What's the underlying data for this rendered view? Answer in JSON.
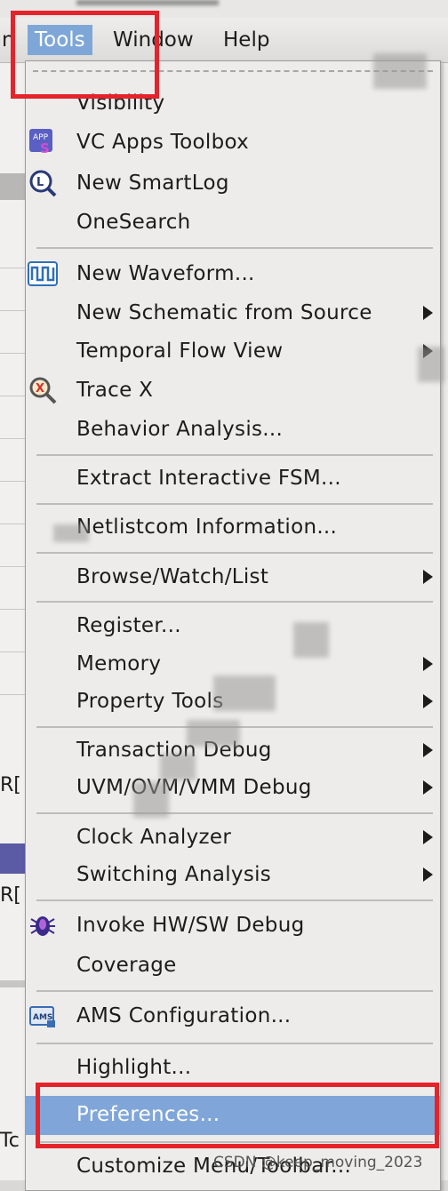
{
  "menubar": {
    "partial_prev_item": "n",
    "tools": "Tools",
    "window": "Window",
    "help": "Help"
  },
  "background": {
    "row_fragment_1": "R[",
    "row_fragment_2": "R[",
    "row_fragment_3": "Tc"
  },
  "tools_menu": {
    "items": [
      {
        "label": "Visibility"
      },
      {
        "label": "VC Apps Toolbox",
        "icon": "vc-apps-icon"
      },
      {
        "label": "New SmartLog",
        "icon": "smartlog-icon"
      },
      {
        "label": "OneSearch"
      },
      {
        "label": "New Waveform...",
        "icon": "waveform-icon"
      },
      {
        "label": "New Schematic from Source",
        "submenu": true
      },
      {
        "label": "Temporal Flow View",
        "submenu": true
      },
      {
        "label": "Trace X",
        "icon": "trace-x-icon"
      },
      {
        "label": "Behavior Analysis..."
      },
      {
        "label": "Extract Interactive FSM..."
      },
      {
        "label": "Netlistcom Information..."
      },
      {
        "label": "Browse/Watch/List",
        "submenu": true
      },
      {
        "label": "Register..."
      },
      {
        "label": "Memory",
        "submenu": true
      },
      {
        "label": "Property Tools",
        "submenu": true
      },
      {
        "label": "Transaction Debug",
        "submenu": true
      },
      {
        "label": "UVM/OVM/VMM Debug",
        "submenu": true
      },
      {
        "label": "Clock Analyzer",
        "submenu": true
      },
      {
        "label": "Switching Analysis",
        "submenu": true
      },
      {
        "label": "Invoke HW/SW Debug",
        "icon": "bug-icon"
      },
      {
        "label": "Coverage"
      },
      {
        "label": "AMS Configuration...",
        "icon": "ams-icon"
      },
      {
        "label": "Highlight..."
      },
      {
        "label": "Preferences...",
        "selected": true
      },
      {
        "label": "Customize Menu/Toolbar..."
      }
    ]
  },
  "watermark": "CSDN @keep_moving_2023",
  "colors": {
    "highlight": "#80a6d9",
    "annotation_red": "#e5232b",
    "menu_bg": "#edeceb"
  }
}
